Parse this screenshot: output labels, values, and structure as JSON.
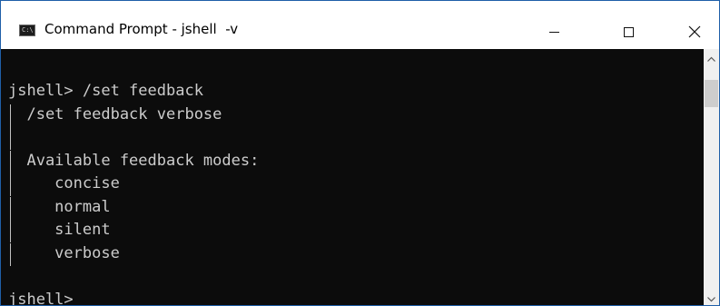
{
  "window": {
    "title": "Command Prompt - jshell  -v",
    "icon_text": "C:\\",
    "controls": {
      "minimize_icon": "minimize-icon",
      "maximize_icon": "maximize-icon",
      "close_icon": "close-icon"
    }
  },
  "console": {
    "lines": [
      {
        "text": "jshell> /set feedback",
        "bar": false
      },
      {
        "text": "  /set feedback verbose",
        "bar": true
      },
      {
        "text": "",
        "bar": true
      },
      {
        "text": "  Available feedback modes:",
        "bar": true
      },
      {
        "text": "     concise",
        "bar": true
      },
      {
        "text": "     normal",
        "bar": true
      },
      {
        "text": "     silent",
        "bar": true
      },
      {
        "text": "     verbose",
        "bar": true
      },
      {
        "text": "",
        "bar": false
      },
      {
        "text": "jshell>",
        "bar": false
      }
    ]
  },
  "colors": {
    "console_bg": "#0c0c0c",
    "console_text": "#cccccc",
    "window_border": "#1f5fa8"
  }
}
